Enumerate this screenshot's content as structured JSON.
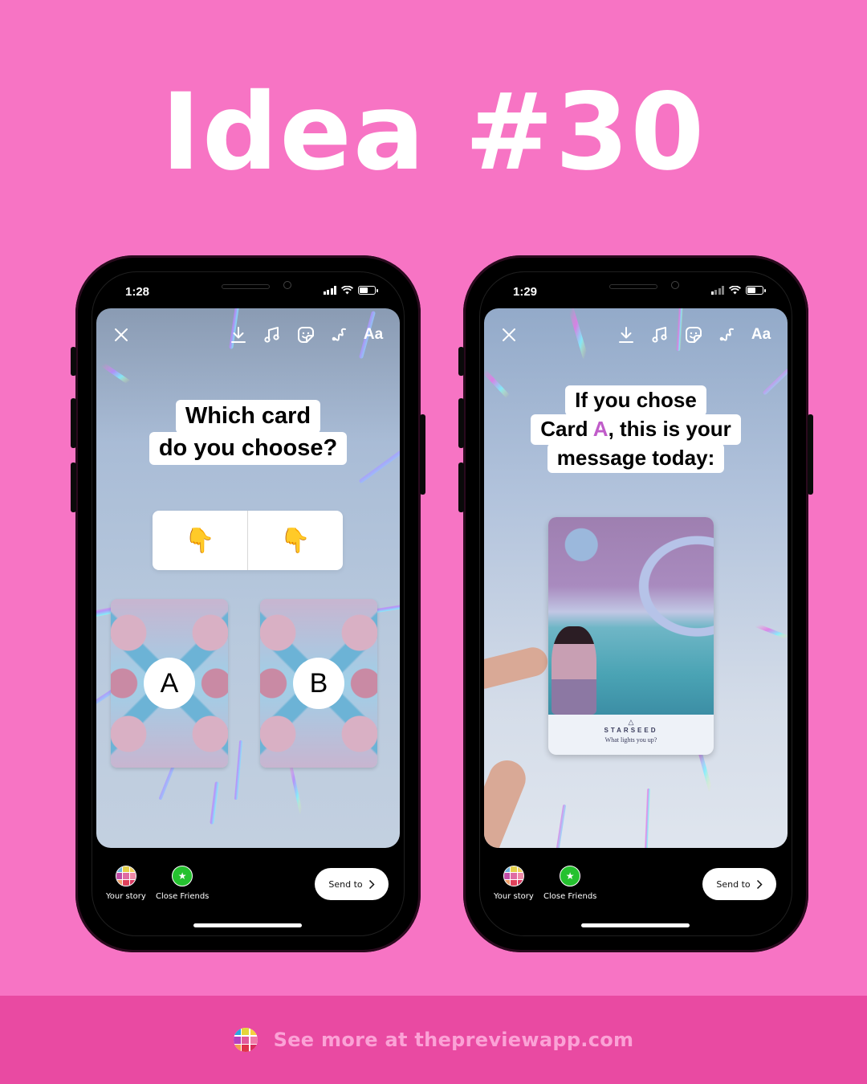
{
  "headline": "Idea #30",
  "footer": {
    "text": "See more at thepreviewapp.com",
    "logo_colors": [
      "#2aa7e0",
      "#e4d63a",
      "#f6d140",
      "#b73fbf",
      "#e25a9a",
      "#f07aa9",
      "#f3a04b",
      "#e0344b",
      "#d92d5e"
    ]
  },
  "colors": {
    "background": "#f774c4",
    "footer_band": "#e94aa2",
    "footer_text": "#fba2d6",
    "caption_accent": "#c05cc9",
    "close_friends_green": "#25c12f"
  },
  "phones": [
    {
      "id": "left",
      "status": {
        "time": "1:28"
      },
      "toolbar": {
        "close_icon": "close-icon",
        "icons": [
          "download-icon",
          "music-icon",
          "sticker-icon",
          "draw-icon"
        ],
        "text_tool_label": "Aa"
      },
      "caption_lines": [
        "Which card",
        "do you choose?"
      ],
      "poll": {
        "options": [
          "👇",
          "👇"
        ]
      },
      "cards": [
        {
          "label": "A"
        },
        {
          "label": "B"
        }
      ],
      "share": {
        "your_story": "Your story",
        "close_friends": "Close Friends",
        "send_to": "Send to"
      }
    },
    {
      "id": "right",
      "status": {
        "time": "1:29"
      },
      "toolbar": {
        "close_icon": "close-icon",
        "icons": [
          "download-icon",
          "music-icon",
          "sticker-icon",
          "draw-icon"
        ],
        "text_tool_label": "Aa"
      },
      "caption": {
        "line1": "If you chose",
        "line2_pre": "Card ",
        "line2_accent": "A",
        "line2_post": ", this is your",
        "line3": "message today:"
      },
      "oracle_card": {
        "symbol": "△",
        "title": "STARSEED",
        "subtitle": "What lights you up?"
      },
      "share": {
        "your_story": "Your story",
        "close_friends": "Close Friends",
        "send_to": "Send to"
      }
    }
  ]
}
